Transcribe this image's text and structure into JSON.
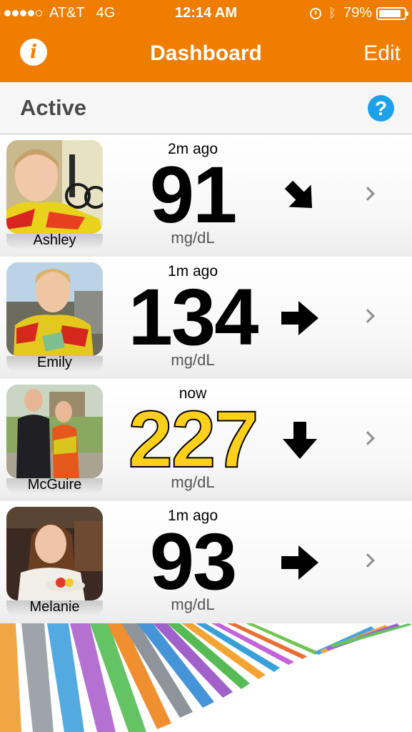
{
  "status_bar": {
    "signal_dots": 5,
    "signal_filled": 4,
    "carrier": "AT&T",
    "network": "4G",
    "time": "12:14 AM",
    "battery": "79%",
    "battery_level": 0.79,
    "icons": [
      "alarm-icon",
      "bluetooth-icon",
      "battery-icon"
    ]
  },
  "nav": {
    "info_icon": "info-icon",
    "title": "Dashboard",
    "edit_label": "Edit"
  },
  "section": {
    "title": "Active",
    "help_icon": "help-icon"
  },
  "colors": {
    "brand_orange": "#ee7d00",
    "help_blue": "#1da1e8",
    "high_value_yellow": "#ffd01a"
  },
  "readings": [
    {
      "name": "Ashley",
      "ago": "2m ago",
      "value": "91",
      "unit": "mg/dL",
      "trend": "down-right-arrow-icon",
      "high": false
    },
    {
      "name": "Emily",
      "ago": "1m ago",
      "value": "134",
      "unit": "mg/dL",
      "trend": "right-arrow-icon",
      "high": false
    },
    {
      "name": "McGuire",
      "ago": "now",
      "value": "227",
      "unit": "mg/dL",
      "trend": "down-arrow-icon",
      "high": true
    },
    {
      "name": "Melanie",
      "ago": "1m ago",
      "value": "93",
      "unit": "mg/dL",
      "trend": "right-arrow-icon",
      "high": false
    }
  ]
}
